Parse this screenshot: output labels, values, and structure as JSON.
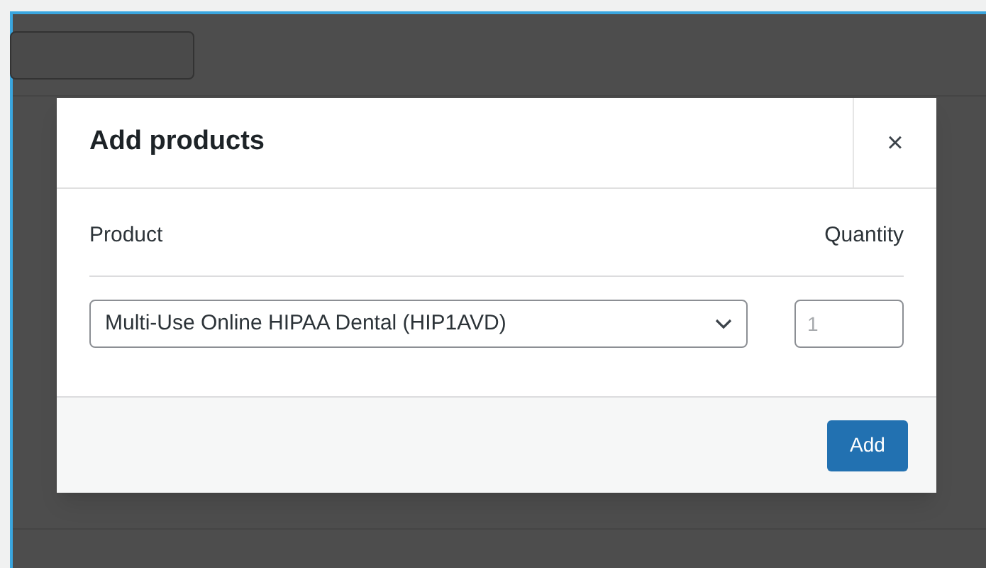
{
  "dialog": {
    "title": "Add products",
    "close": "×"
  },
  "columns": [
    "Product",
    "Quantity"
  ],
  "row": {
    "product": "Multi-Use Online HIPAA Dental (HIP1AVD)",
    "quantity_placeholder": "1"
  },
  "buttons": [
    "Add"
  ]
}
